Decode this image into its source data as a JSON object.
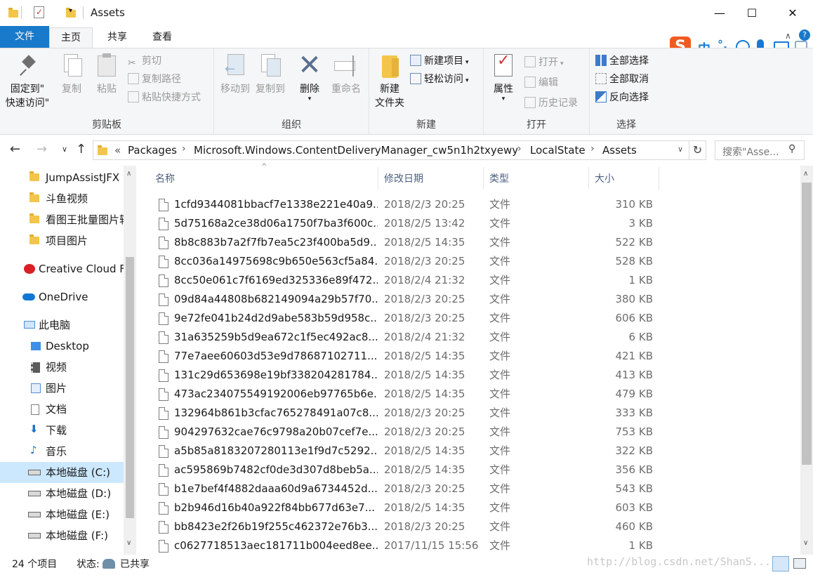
{
  "window": {
    "title": "Assets",
    "minimize": "—",
    "maximize": "☐",
    "close": "✕"
  },
  "tabs": {
    "file": "文件",
    "home": "主页",
    "share": "共享",
    "view": "查看"
  },
  "ribbon": {
    "clipboard": {
      "pin_label_1": "固定到\"",
      "pin_label_2": "快速访问\"",
      "copy": "复制",
      "paste": "粘贴",
      "cut": "剪切",
      "copy_path": "复制路径",
      "paste_shortcut": "粘贴快捷方式",
      "group": "剪贴板"
    },
    "organize": {
      "move_to": "移动到",
      "copy_to": "复制到",
      "delete": "删除",
      "rename": "重命名",
      "group": "组织"
    },
    "new": {
      "new_folder_1": "新建",
      "new_folder_2": "文件夹",
      "new_item": "新建项目",
      "easy_access": "轻松访问",
      "group": "新建"
    },
    "open": {
      "properties": "属性",
      "open": "打开",
      "edit": "编辑",
      "history": "历史记录",
      "group": "打开"
    },
    "select": {
      "select_all": "全部选择",
      "select_none": "全部取消",
      "invert": "反向选择",
      "group": "选择"
    }
  },
  "ime": {
    "mode": "中",
    "punct": "°,"
  },
  "address": {
    "overflow": "«",
    "crumbs": [
      "Packages",
      "Microsoft.Windows.ContentDeliveryManager_cw5n1h2txyewy",
      "LocalState",
      "Assets"
    ],
    "search_placeholder": "搜索\"Asse..."
  },
  "nav": {
    "items": [
      "JumpAssistJFX",
      "斗鱼视频",
      "看图王批量图片转",
      "项目图片",
      "Creative Cloud F",
      "OneDrive",
      "此电脑",
      "Desktop",
      "视频",
      "图片",
      "文档",
      "下载",
      "音乐",
      "本地磁盘 (C:)",
      "本地磁盘 (D:)",
      "本地磁盘 (E:)",
      "本地磁盘 (F:)"
    ]
  },
  "columns": {
    "name": "名称",
    "date": "修改日期",
    "type": "类型",
    "size": "大小"
  },
  "files": [
    {
      "name": "1cfd9344081bbacf7e1338e221e40a9...",
      "date": "2018/2/3 20:25",
      "type": "文件",
      "size": "310 KB"
    },
    {
      "name": "5d75168a2ce38d06a1750f7ba3f600c...",
      "date": "2018/2/5 13:42",
      "type": "文件",
      "size": "3 KB"
    },
    {
      "name": "8b8c883b7a2f7fb7ea5c23f400ba5d9...",
      "date": "2018/2/5 14:35",
      "type": "文件",
      "size": "522 KB"
    },
    {
      "name": "8cc036a14975698c9b650e563cf5a84...",
      "date": "2018/2/3 20:25",
      "type": "文件",
      "size": "528 KB"
    },
    {
      "name": "8cc50e061c7f6169ed325336e89f472...",
      "date": "2018/2/4 21:32",
      "type": "文件",
      "size": "1 KB"
    },
    {
      "name": "09d84a44808b682149094a29b57f70...",
      "date": "2018/2/3 20:25",
      "type": "文件",
      "size": "380 KB"
    },
    {
      "name": "9e72fe041b24d2d9abe583b59d958c...",
      "date": "2018/2/3 20:25",
      "type": "文件",
      "size": "606 KB"
    },
    {
      "name": "31a635259b5d9ea672c1f5ec492ac8...",
      "date": "2018/2/4 21:32",
      "type": "文件",
      "size": "6 KB"
    },
    {
      "name": "77e7aee60603d53e9d78687102711...",
      "date": "2018/2/5 14:35",
      "type": "文件",
      "size": "421 KB"
    },
    {
      "name": "131c29d653698e19bf338204281784...",
      "date": "2018/2/5 14:35",
      "type": "文件",
      "size": "413 KB"
    },
    {
      "name": "473ac234075549192006eb97765b6e...",
      "date": "2018/2/5 14:35",
      "type": "文件",
      "size": "479 KB"
    },
    {
      "name": "132964b861b3cfac765278491a07c8...",
      "date": "2018/2/3 20:25",
      "type": "文件",
      "size": "333 KB"
    },
    {
      "name": "904297632cae76c9798a20b07cef7e...",
      "date": "2018/2/3 20:25",
      "type": "文件",
      "size": "753 KB"
    },
    {
      "name": "a5b85a8183207280113e1f9d7c5292...",
      "date": "2018/2/5 14:35",
      "type": "文件",
      "size": "322 KB"
    },
    {
      "name": "ac595869b7482cf0de3d307d8beb5a...",
      "date": "2018/2/5 14:35",
      "type": "文件",
      "size": "356 KB"
    },
    {
      "name": "b1e7bef4f4882daaa60d9a6734452d...",
      "date": "2018/2/3 20:25",
      "type": "文件",
      "size": "543 KB"
    },
    {
      "name": "b2b946d16b40a922f84bb677d63e7...",
      "date": "2018/2/5 14:35",
      "type": "文件",
      "size": "603 KB"
    },
    {
      "name": "bb8423e2f26b19f255c462372e76b3...",
      "date": "2018/2/3 20:25",
      "type": "文件",
      "size": "460 KB"
    },
    {
      "name": "c0627718513aec181711b004eed8ee...",
      "date": "2017/11/15 15:56",
      "type": "文件",
      "size": "1 KB"
    }
  ],
  "status": {
    "count": "24 个项目",
    "state_label": "状态:",
    "shared": "已共享",
    "watermark": "http://blog.csdn.net/ShanS..."
  },
  "colors": {
    "accent": "#1979ca",
    "selection": "#cce8ff",
    "folder": "#f3c54a"
  }
}
